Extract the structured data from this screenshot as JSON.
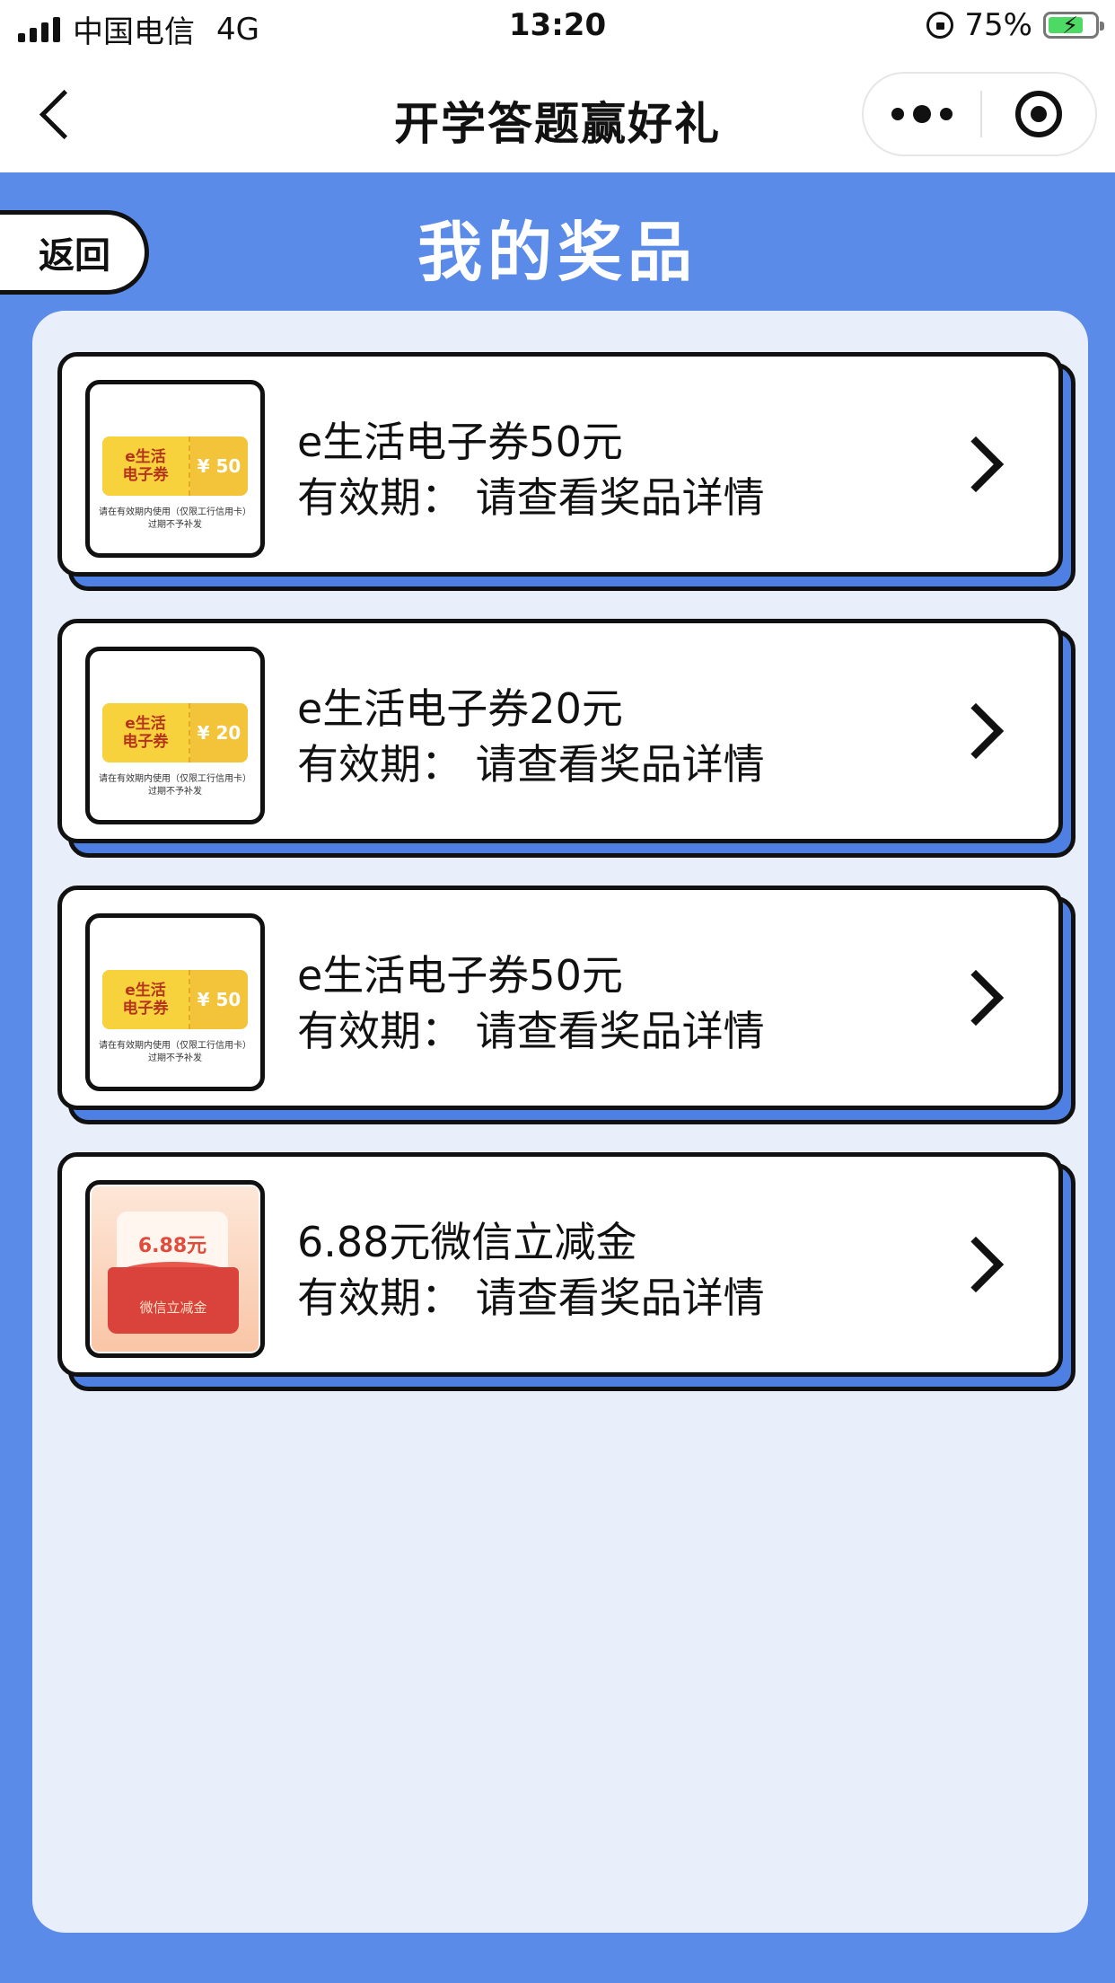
{
  "status_bar": {
    "carrier": "中国电信",
    "network": "4G",
    "time": "13:20",
    "battery": "75%",
    "battery_level": 0.75
  },
  "nav": {
    "title": "开学答题赢好礼",
    "back_icon": "chevron-left-icon",
    "more_icon": "more-dots-icon",
    "close_icon": "target-circle-icon"
  },
  "page": {
    "return_label": "返回",
    "title": "我的奖品"
  },
  "prizes": [
    {
      "name": "e生活电子券50元",
      "validity": "有效期：  请查看奖品详情",
      "thumb_type": "coupon",
      "coupon_title_1": "e生活",
      "coupon_title_2": "电子券",
      "amount": "¥ 50",
      "note_1": "请在有效期内使用（仅限工行信用卡）",
      "note_2": "过期不予补发"
    },
    {
      "name": "e生活电子券20元",
      "validity": "有效期：  请查看奖品详情",
      "thumb_type": "coupon",
      "coupon_title_1": "e生活",
      "coupon_title_2": "电子券",
      "amount": "¥ 20",
      "note_1": "请在有效期内使用（仅限工行信用卡）",
      "note_2": "过期不予补发"
    },
    {
      "name": "e生活电子券50元",
      "validity": "有效期：  请查看奖品详情",
      "thumb_type": "coupon",
      "coupon_title_1": "e生活",
      "coupon_title_2": "电子券",
      "amount": "¥ 50",
      "note_1": "请在有效期内使用（仅限工行信用卡）",
      "note_2": "过期不予补发"
    },
    {
      "name": "6.88元微信立减金",
      "validity": "有效期：  请查看奖品详情",
      "thumb_type": "redpack",
      "rp_amount": "6.88元",
      "rp_label": "微信立减金"
    }
  ],
  "colors": {
    "background": "#5b8be8",
    "panel": "#e9eefb",
    "card_shadow": "#4e7fe2",
    "coupon": "#f3c33a",
    "coupon_text": "#b5341c",
    "redpack": "#d9433b"
  }
}
